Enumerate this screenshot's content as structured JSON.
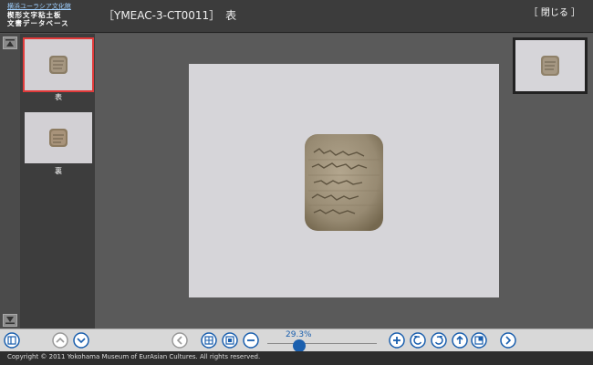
{
  "header": {
    "museum_link": "横浜ユーラシア文化館",
    "db_line1": "楔形文字粘土板",
    "db_line2": "文書データベース",
    "title": "［YMEAC-3-CT0011］　表",
    "close_label": "［ 閉じる ］"
  },
  "thumbnails": [
    {
      "label": "表",
      "selected": true
    },
    {
      "label": "裏",
      "selected": false
    }
  ],
  "toolbar": {
    "zoom_level": "29.3%",
    "zoom_fraction": 0.293
  },
  "footer": {
    "copyright": "Copyright © 2011 Yokohama Museum of EurAsian Cultures. All rights reserved."
  },
  "colors": {
    "accent": "#1a5fae",
    "selected_outline": "#e03a3a"
  }
}
